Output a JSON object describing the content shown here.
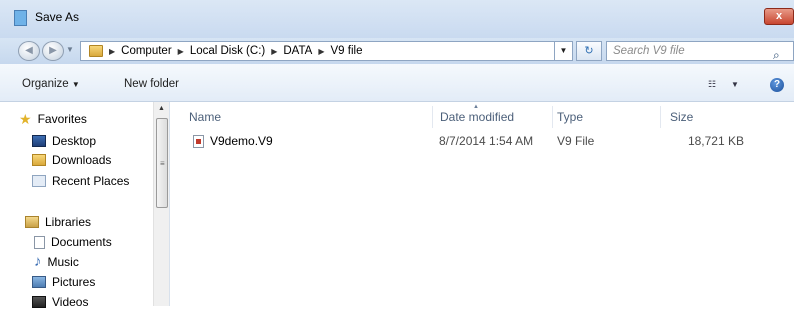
{
  "window": {
    "title": "Save As",
    "close_label": "x",
    "close_icon": "close-icon"
  },
  "nav": {
    "back_icon": "back-arrow-icon",
    "forward_icon": "forward-arrow-icon",
    "path": [
      "Computer",
      "Local Disk (C:)",
      "DATA",
      "V9 file"
    ],
    "separator": "▶",
    "search_placeholder": "Search V9 file"
  },
  "toolbar": {
    "organize": "Organize",
    "new_folder": "New folder"
  },
  "sidebar": {
    "favorites": "Favorites",
    "favorite_items": [
      "Desktop",
      "Downloads",
      "Recent Places"
    ],
    "libraries": "Libraries",
    "library_items": [
      "Documents",
      "Music",
      "Pictures",
      "Videos"
    ]
  },
  "columns": {
    "name": "Name",
    "date": "Date modified",
    "type": "Type",
    "size": "Size",
    "sort": "name-ascending"
  },
  "files": [
    {
      "name": "V9demo.V9",
      "date": "8/7/2014 1:54 AM",
      "type": "V9 File",
      "size": "18,721 KB"
    }
  ],
  "colors": {
    "titlebar": "#c9daf0",
    "close": "#c84630",
    "accent": "#2f6fb3"
  }
}
